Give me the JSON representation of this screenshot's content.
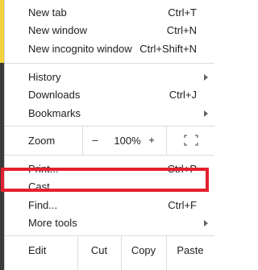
{
  "theme": {
    "highlight_color": "#e5202e",
    "text_color": "#202124",
    "separator_color": "#dadce0"
  },
  "menu": {
    "new_tab": {
      "label": "New tab",
      "shortcut": "Ctrl+T"
    },
    "new_window": {
      "label": "New window",
      "shortcut": "Ctrl+N"
    },
    "new_incognito": {
      "label": "New incognito window",
      "shortcut": "Ctrl+Shift+N"
    },
    "history": {
      "label": "History"
    },
    "downloads": {
      "label": "Downloads",
      "shortcut": "Ctrl+J"
    },
    "bookmarks": {
      "label": "Bookmarks"
    },
    "zoom": {
      "label": "Zoom",
      "minus": "–",
      "value": "100%",
      "plus": "+",
      "fullscreen_icon": "fullscreen-icon"
    },
    "print": {
      "label": "Print...",
      "shortcut": "Ctrl+P"
    },
    "cast": {
      "label": "Cast..."
    },
    "find": {
      "label": "Find...",
      "shortcut": "Ctrl+F"
    },
    "more_tools": {
      "label": "More tools"
    },
    "edit": {
      "label": "Edit",
      "cut": "Cut",
      "copy": "Copy",
      "paste": "Paste"
    }
  }
}
